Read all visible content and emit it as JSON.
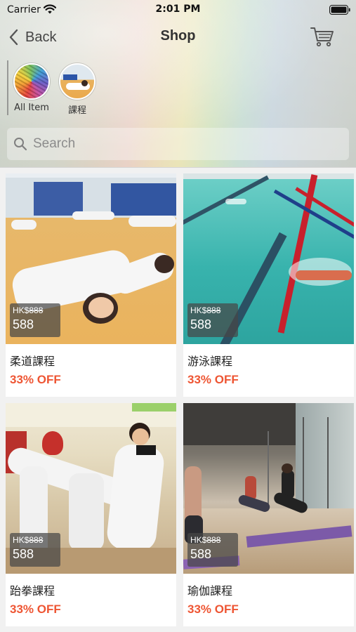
{
  "status_bar": {
    "carrier": "Carrier",
    "time": "2:01 PM",
    "wifi_icon": "wifi-icon",
    "battery_icon": "battery-icon"
  },
  "nav": {
    "back_label": "Back",
    "title": "Shop",
    "cart_icon": "cart-icon"
  },
  "categories": [
    {
      "label": "All Item",
      "icon": "rainbow-thumbnail"
    },
    {
      "label": "課程",
      "icon": "class-thumbnail"
    }
  ],
  "search": {
    "placeholder": "Search",
    "icon": "search-icon"
  },
  "products": [
    {
      "name": "柔道課程",
      "currency": "HK$",
      "original_price": "888",
      "sale_price": "588",
      "discount": "33% OFF"
    },
    {
      "name": "游泳課程",
      "currency": "HK$",
      "original_price": "888",
      "sale_price": "588",
      "discount": "33% OFF"
    },
    {
      "name": "跆拳課程",
      "currency": "HK$",
      "original_price": "888",
      "sale_price": "588",
      "discount": "33% OFF"
    },
    {
      "name": "瑜伽課程",
      "currency": "HK$",
      "original_price": "888",
      "sale_price": "588",
      "discount": "33% OFF"
    }
  ],
  "colors": {
    "discount": "#ee5533",
    "background": "#f1f1f1"
  }
}
